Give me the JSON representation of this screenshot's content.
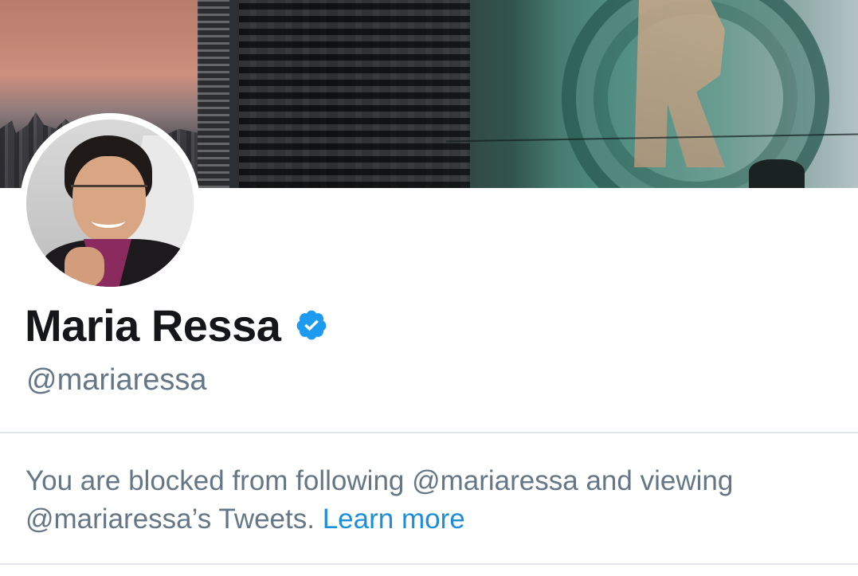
{
  "profile": {
    "display_name": "Maria Ressa",
    "handle": "@mariaressa",
    "verified": true
  },
  "block_notice": {
    "text": "You are blocked from following @mariaressa and viewing @mariaressa’s Tweets.",
    "link_label": "Learn more"
  },
  "colors": {
    "link": "#1d8fd8",
    "muted_text": "#657786",
    "name_text": "#141619",
    "verified_badge": "#1d9bf0"
  }
}
